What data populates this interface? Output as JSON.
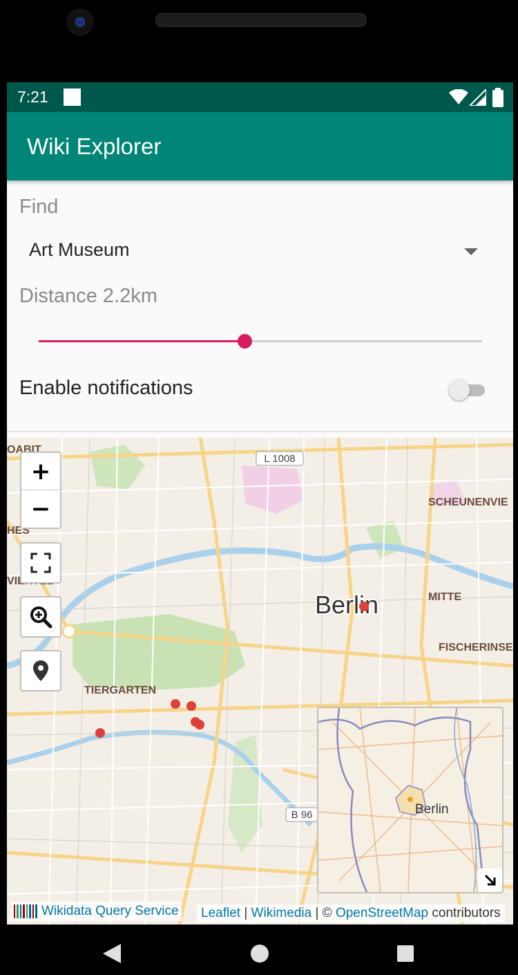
{
  "status_bar": {
    "time": "7:21"
  },
  "app_bar": {
    "title": "Wiki Explorer"
  },
  "find": {
    "label": "Find",
    "selected": "Art Museum"
  },
  "distance": {
    "label": "Distance 2.2km",
    "slider_fraction": 0.464
  },
  "notifications": {
    "label": "Enable notifications",
    "enabled": false
  },
  "map": {
    "zoom_in": "+",
    "zoom_out": "−",
    "city_label": "Berlin",
    "labels": {
      "l1008": "L 1008",
      "b96": "B 96",
      "scheunen": "SCHEUNENVIE",
      "mitte": "MITTE",
      "fischer": "FISCHERINSE",
      "tiergarten": "TIERGARTEN",
      "dabit": "OABIT",
      "hes": "HES",
      "viertel": "VIERTEL"
    },
    "minimap_label": "Berlin",
    "attribution_left": "Wikidata Query Service",
    "attribution_right": {
      "leaflet": "Leaflet",
      "sep1": " | ",
      "wikimedia": "Wikimedia",
      "sep2": " | © ",
      "osm": "OpenStreetMap",
      "contributors": " contributors"
    }
  },
  "colors": {
    "status_bar": "#00574b",
    "app_bar": "#008577",
    "accent": "#d81b60",
    "marker": "#e0403a",
    "water": "#a9d1ec",
    "park": "#c8e2b4"
  }
}
